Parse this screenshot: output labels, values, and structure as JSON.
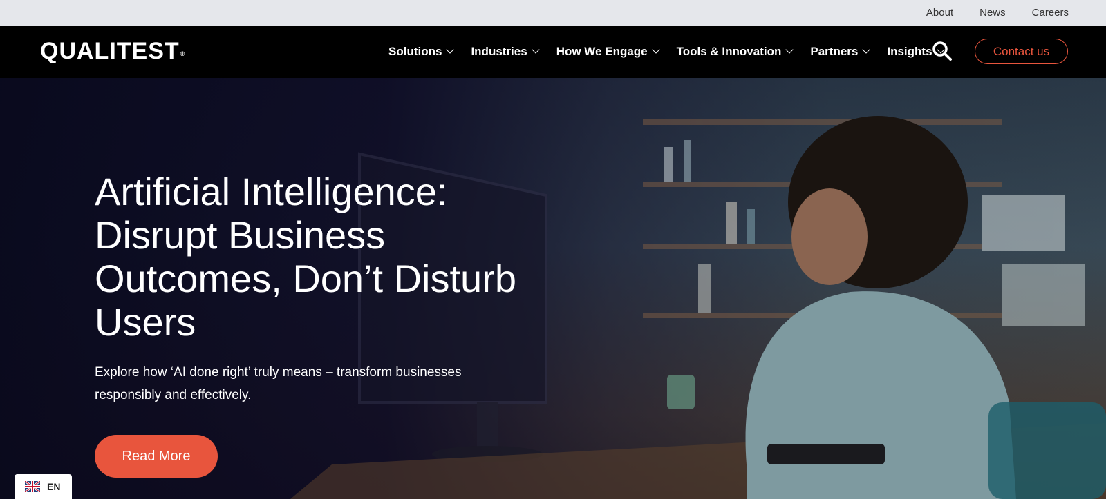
{
  "top_links": [
    "About",
    "News",
    "Careers"
  ],
  "brand": {
    "name": "QUALITEST",
    "mark": "®"
  },
  "nav": {
    "items": [
      "Solutions",
      "Industries",
      "How We Engage",
      "Tools & Innovation",
      "Partners",
      "Insights"
    ],
    "search_icon": "search-icon",
    "contact_label": "Contact us"
  },
  "hero": {
    "headline": "Artificial Intelligence: Disrupt Business Outcomes, Don’t Disturb Users",
    "subtext": "Explore how ‘AI done right’ truly means – transform businesses responsibly and effectively.",
    "cta_label": "Read More"
  },
  "language": {
    "code": "EN",
    "flag_icon": "uk-flag-icon"
  },
  "colors": {
    "accent": "#e8553d",
    "nav_bg": "#000000",
    "topbar_bg": "#e5e7eb"
  }
}
